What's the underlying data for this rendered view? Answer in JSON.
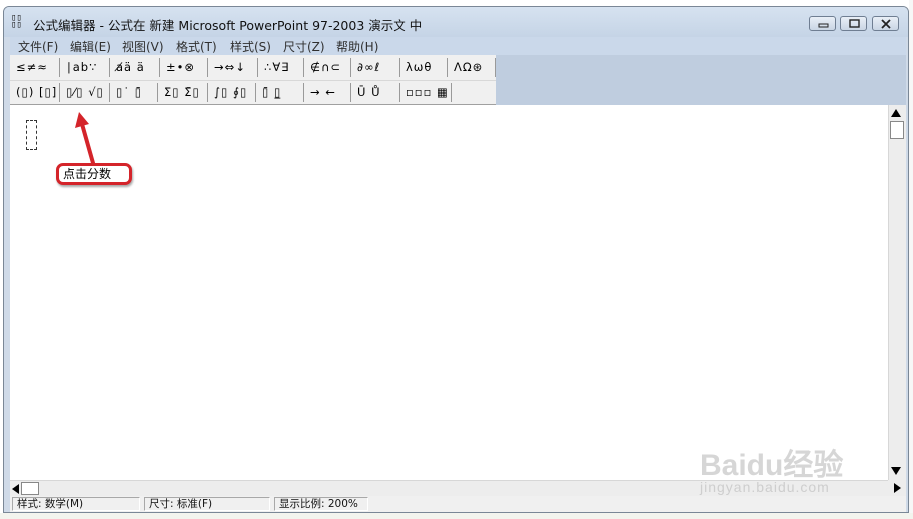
{
  "window": {
    "title": "公式编辑器 - 公式在 新建 Microsoft PowerPoint 97-2003 演示文 中"
  },
  "menu": {
    "items": [
      {
        "label": "文件(F)"
      },
      {
        "label": "编辑(E)"
      },
      {
        "label": "视图(V)"
      },
      {
        "label": "格式(T)"
      },
      {
        "label": "样式(S)"
      },
      {
        "label": "尺寸(Z)"
      },
      {
        "label": "帮助(H)"
      }
    ]
  },
  "toolbar": {
    "row1": [
      {
        "label": "≤≠≈",
        "icon": "relational-symbols-icon"
      },
      {
        "label": "∣ab∵",
        "icon": "spaces-ellipses-icon"
      },
      {
        "label": "a̸ä ä",
        "icon": "embellishments-icon"
      },
      {
        "label": "±•⊗",
        "icon": "operator-symbols-icon"
      },
      {
        "label": "→⇔↓",
        "icon": "arrow-symbols-icon"
      },
      {
        "label": "∴∀∃",
        "icon": "logical-symbols-icon"
      },
      {
        "label": "∉∩⊂",
        "icon": "set-theory-icon"
      },
      {
        "label": "∂∞ℓ",
        "icon": "misc-symbols-icon"
      },
      {
        "label": "λωθ",
        "icon": "greek-lowercase-icon"
      },
      {
        "label": "ΛΩ⊛",
        "icon": "greek-uppercase-icon"
      }
    ],
    "row2": [
      {
        "label": "(▯) [▯]",
        "icon": "fence-templates-icon"
      },
      {
        "label": "▯⁄▯ √▯",
        "icon": "fraction-radical-templates-icon"
      },
      {
        "label": "▯˙ ▯̄",
        "icon": "subscript-superscript-templates-icon"
      },
      {
        "label": "Σ▯ Σ̄▯",
        "icon": "summation-templates-icon"
      },
      {
        "label": "∫▯ ∮▯",
        "icon": "integral-templates-icon"
      },
      {
        "label": "▯̄ ▯̲",
        "icon": "underbar-overbar-templates-icon"
      },
      {
        "label": "→ ←",
        "icon": "labeled-arrow-templates-icon"
      },
      {
        "label": "Ū Ů",
        "icon": "products-set-theory-templates-icon"
      },
      {
        "label": "▫▫▫ ▦",
        "icon": "matrix-templates-icon"
      }
    ]
  },
  "annotation": {
    "callout_text": "点击分数",
    "color": "#d4242a"
  },
  "status": {
    "style": "样式: 数学(M)",
    "size": "尺寸: 标准(F)",
    "zoom": "显示比例: 200%"
  },
  "watermark": {
    "brand": "Baidu经验",
    "url": "jingyan.baidu.com"
  },
  "colors": {
    "titlebar": "#d6e2f0",
    "menubar": "#cad8ea",
    "toolbar_bg": "#f0f0f0"
  }
}
